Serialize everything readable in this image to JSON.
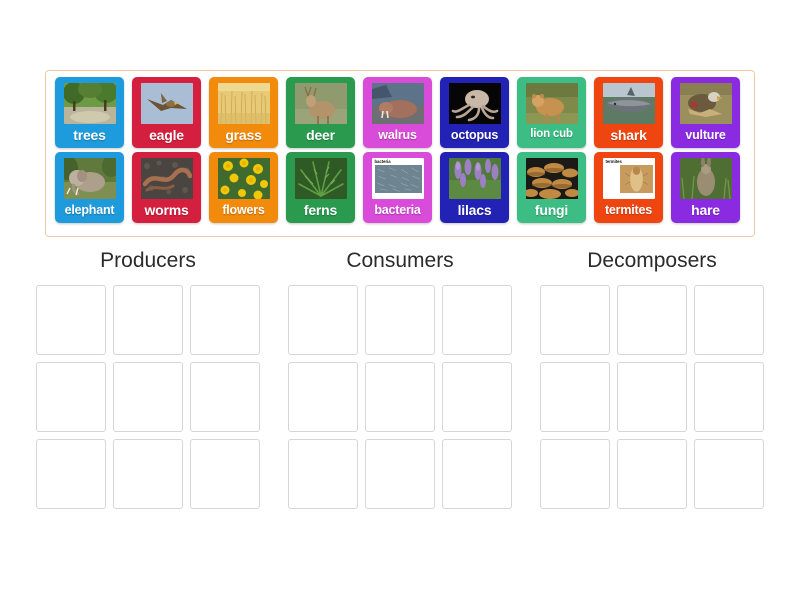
{
  "activity": {
    "type": "group-sort",
    "tray_border_color": "#f0c9a0"
  },
  "tiles": [
    {
      "id": "trees",
      "label": "trees",
      "color": "#1e9bdc",
      "image": "trees-photo",
      "size": "normal"
    },
    {
      "id": "eagle",
      "label": "eagle",
      "color": "#d41f3f",
      "image": "eagle-photo",
      "size": "normal"
    },
    {
      "id": "grass",
      "label": "grass",
      "color": "#f28a0c",
      "image": "grass-photo",
      "size": "normal"
    },
    {
      "id": "deer",
      "label": "deer",
      "color": "#2a9a4e",
      "image": "deer-photo",
      "size": "normal"
    },
    {
      "id": "walrus",
      "label": "walrus",
      "color": "#d94bd9",
      "image": "walrus-photo",
      "size": "small"
    },
    {
      "id": "octopus",
      "label": "octopus",
      "color": "#2222b4",
      "image": "octopus-photo",
      "size": "small"
    },
    {
      "id": "lion-cub",
      "label": "lion cub",
      "color": "#3bbd84",
      "image": "lion-cub-photo",
      "size": "xsmall"
    },
    {
      "id": "shark",
      "label": "shark",
      "color": "#ef4611",
      "image": "shark-photo",
      "size": "normal"
    },
    {
      "id": "vulture",
      "label": "vulture",
      "color": "#8a2be2",
      "image": "vulture-photo",
      "size": "small"
    },
    {
      "id": "elephant",
      "label": "elephant",
      "color": "#1e9bdc",
      "image": "elephant-photo",
      "size": "small"
    },
    {
      "id": "worms",
      "label": "worms",
      "color": "#d41f3f",
      "image": "worms-photo",
      "size": "normal"
    },
    {
      "id": "flowers",
      "label": "flowers",
      "color": "#f28a0c",
      "image": "flowers-photo",
      "size": "small"
    },
    {
      "id": "ferns",
      "label": "ferns",
      "color": "#2a9a4e",
      "image": "ferns-photo",
      "size": "normal"
    },
    {
      "id": "bacteria",
      "label": "bacteria",
      "color": "#d94bd9",
      "image": "bacteria-card",
      "size": "small",
      "caption": "bacteria"
    },
    {
      "id": "lilacs",
      "label": "lilacs",
      "color": "#2222b4",
      "image": "lilacs-photo",
      "size": "normal"
    },
    {
      "id": "fungi",
      "label": "fungi",
      "color": "#3bbd84",
      "image": "fungi-photo",
      "size": "normal"
    },
    {
      "id": "termites",
      "label": "termites",
      "color": "#ef4611",
      "image": "termites-card",
      "size": "small",
      "caption": "termites"
    },
    {
      "id": "hare",
      "label": "hare",
      "color": "#8a2be2",
      "image": "hare-photo",
      "size": "normal"
    }
  ],
  "categories": [
    {
      "id": "producers",
      "title": "Producers",
      "slots": 9
    },
    {
      "id": "consumers",
      "title": "Consumers",
      "slots": 9
    },
    {
      "id": "decomposers",
      "title": "Decomposers",
      "slots": 9
    }
  ]
}
